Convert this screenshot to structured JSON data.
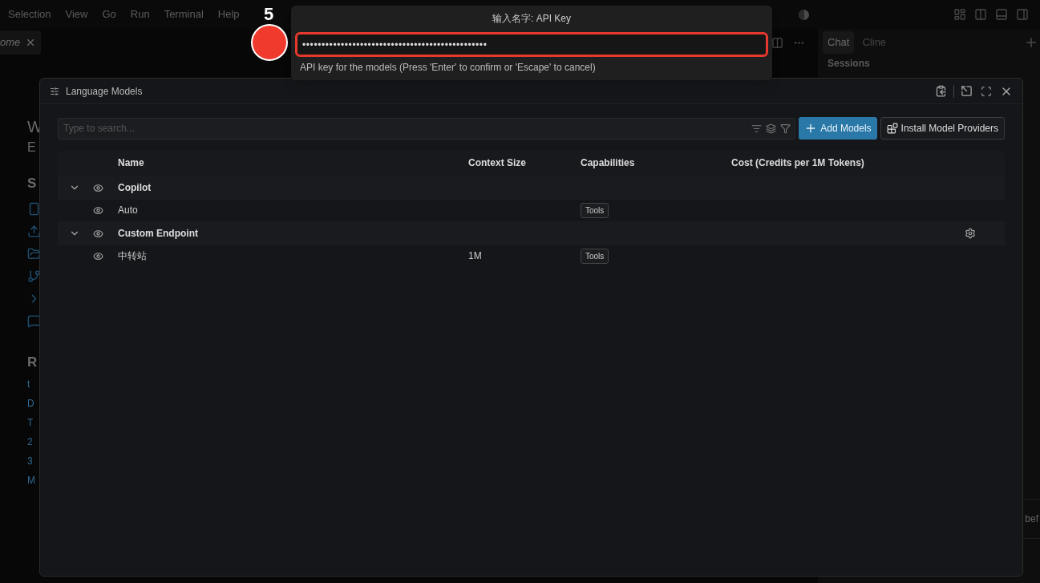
{
  "menu_bar": {
    "items": [
      "Selection",
      "View",
      "Go",
      "Run",
      "Terminal",
      "Help"
    ]
  },
  "editor_tabs": [
    {
      "label": "ome",
      "selected": true
    }
  ],
  "welcome_page_partial": {
    "heading": "W",
    "subheading": "E",
    "start_heading": "S",
    "recent_heading": "R",
    "recent_items": [
      "t",
      "D",
      "T",
      "2",
      "3",
      "M"
    ]
  },
  "chat_panel": {
    "tabs": [
      {
        "label": "Chat",
        "selected": true
      },
      {
        "label": "Cline",
        "selected": false
      }
    ],
    "section": "Sessions",
    "notice_partial": "bef"
  },
  "quick_input": {
    "title": "输入名字: API Key",
    "value": "••••••••••••••••••••••••••••••••••••••••••••••••",
    "hint": "API key for the models (Press 'Enter' to confirm or 'Escape' to cancel)"
  },
  "annotation": {
    "step": "5"
  },
  "language_models_dialog": {
    "title": "Language Models",
    "search": {
      "placeholder": "Type to search..."
    },
    "buttons": [
      {
        "label": "Add Models",
        "kind": "primary"
      },
      {
        "label": "Install Model Providers",
        "kind": "secondary"
      }
    ],
    "columns": [
      "Name",
      "Context Size",
      "Capabilities",
      "Cost (Credits per 1M Tokens)"
    ],
    "groups": [
      {
        "name": "Copilot",
        "expanded": true,
        "configurable": false,
        "models": [
          {
            "name": "Auto",
            "capabilities": [
              "Tools"
            ]
          }
        ]
      },
      {
        "name": "Custom Endpoint",
        "expanded": true,
        "configurable": true,
        "models": [
          {
            "name": "中转站",
            "context_size": "1M",
            "capabilities": [
              "Tools"
            ]
          }
        ]
      }
    ]
  }
}
